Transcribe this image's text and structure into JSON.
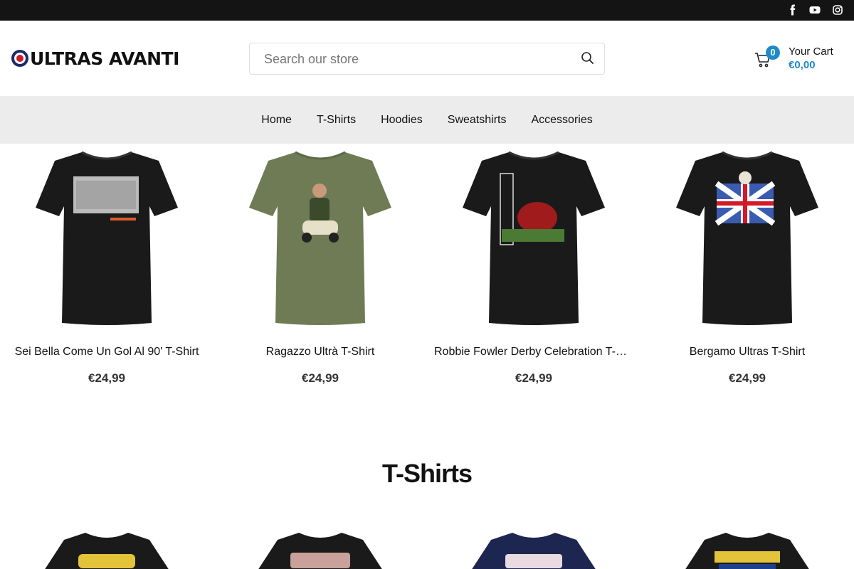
{
  "topbar": {
    "social": [
      "facebook-icon",
      "youtube-icon",
      "instagram-icon"
    ]
  },
  "header": {
    "logo_text": "ULTRAS AVANTI",
    "search_placeholder": "Search our store",
    "cart_count": "0",
    "cart_label": "Your Cart",
    "cart_total": "€0,00"
  },
  "nav": {
    "items": [
      {
        "label": "Home"
      },
      {
        "label": "T-Shirts"
      },
      {
        "label": "Hoodies"
      },
      {
        "label": "Sweatshirts"
      },
      {
        "label": "Accessories"
      }
    ]
  },
  "products": [
    {
      "title": "Sei Bella Come Un Gol Al 90' T-Shirt",
      "price": "€24,99",
      "shirt_color": "#1a1a1a"
    },
    {
      "title": "Ragazzo Ultrà T-Shirt",
      "price": "€24,99",
      "shirt_color": "#6e7b55"
    },
    {
      "title": "Robbie Fowler Derby Celebration T-Shirt",
      "price": "€24,99",
      "shirt_color": "#1a1a1a"
    },
    {
      "title": "Bergamo Ultras T-Shirt",
      "price": "€24,99",
      "shirt_color": "#1a1a1a"
    }
  ],
  "section": {
    "title": "T-Shirts"
  },
  "colors": {
    "accent": "#1e8ac9",
    "topbar": "#141414",
    "nav_bg": "#ececec"
  }
}
